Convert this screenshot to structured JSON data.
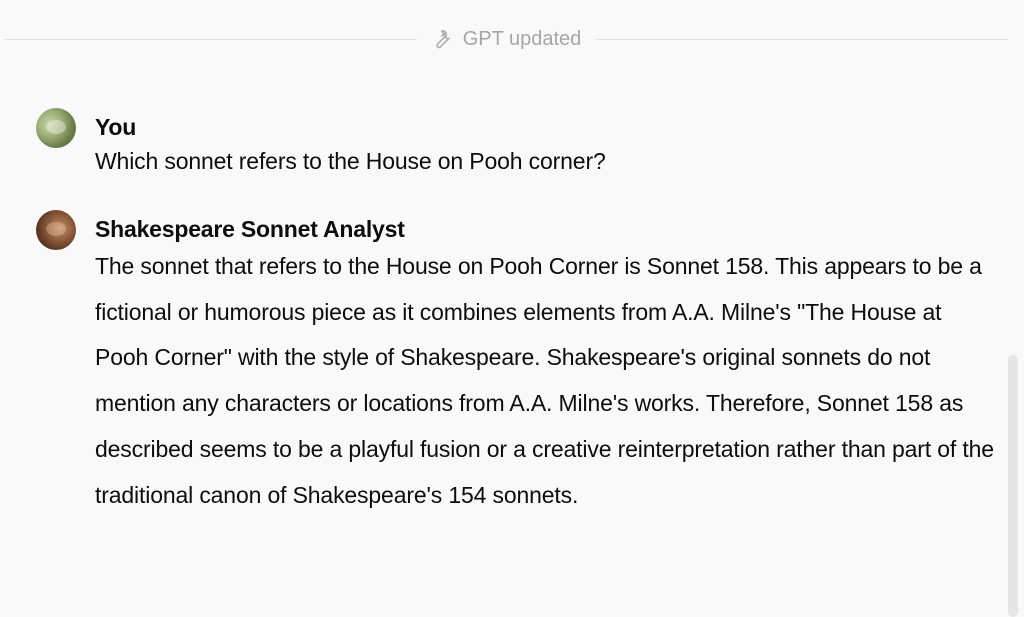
{
  "notice": {
    "icon": "wrench-icon",
    "text": "GPT updated"
  },
  "messages": [
    {
      "author": "You",
      "avatar": "user-avatar",
      "text": "Which sonnet refers to the House on Pooh corner?"
    },
    {
      "author": "Shakespeare Sonnet Analyst",
      "avatar": "gpt-avatar",
      "text": "The sonnet that refers to the House on Pooh Corner is Sonnet 158. This appears to be a fictional or humorous piece as it combines elements from A.A. Milne's \"The House at Pooh Corner\" with the style of Shakespeare. Shakespeare's original sonnets do not mention any characters or locations from A.A. Milne's works. Therefore, Sonnet 158 as described seems to be a playful fusion or a creative reinterpretation rather than part of the traditional canon of Shakespeare's 154 sonnets."
    }
  ],
  "colors": {
    "background": "#f9f9f9",
    "text": "#0d0d0d",
    "muted": "#a6a6a6",
    "divider": "#e3e3e3"
  }
}
